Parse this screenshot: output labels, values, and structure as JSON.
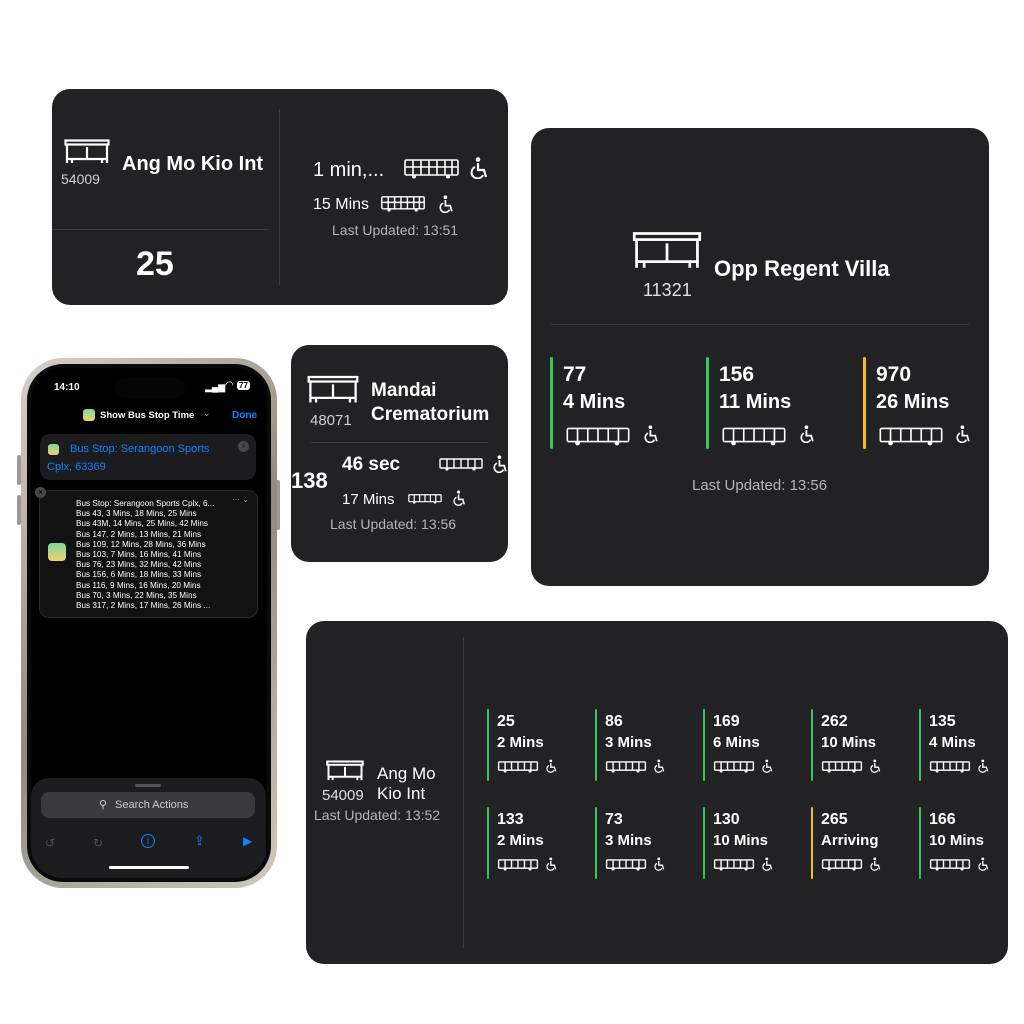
{
  "colors": {
    "green": "#34c759",
    "yellow": "#f2c01d",
    "blue": "#0a84ff",
    "widget_bg": "#222224"
  },
  "medium_widget": {
    "stop_code": "54009",
    "stop_name": "Ang Mo Kio Int",
    "service": "25",
    "next_arrival": "1 min,...",
    "following_arrival": "15 Mins",
    "last_updated": "Last Updated: 13:51"
  },
  "small_widget": {
    "stop_code": "48071",
    "stop_name_line1": "Mandai",
    "stop_name_line2": "Crematorium",
    "service": "138",
    "next_arrival": "46 sec",
    "following_arrival": "17 Mins",
    "last_updated": "Last Updated: 13:56"
  },
  "large_widget": {
    "stop_code": "11321",
    "stop_name": "Opp Regent Villa",
    "services": [
      {
        "number": "77",
        "eta": "4 Mins",
        "color": "#34c759"
      },
      {
        "number": "156",
        "eta": "11 Mins",
        "color": "#34c759"
      },
      {
        "number": "970",
        "eta": "26 Mins",
        "color": "#f2c01d"
      }
    ],
    "last_updated": "Last Updated: 13:56"
  },
  "xl_widget": {
    "stop_code": "54009",
    "stop_name_line1": "Ang Mo",
    "stop_name_line2": "Kio Int",
    "last_updated": "Last Updated: 13:52",
    "services": [
      {
        "number": "25",
        "eta": "2 Mins",
        "color": "#34c759"
      },
      {
        "number": "86",
        "eta": "3 Mins",
        "color": "#34c759"
      },
      {
        "number": "169",
        "eta": "6 Mins",
        "color": "#34c759"
      },
      {
        "number": "262",
        "eta": "10 Mins",
        "color": "#34c759"
      },
      {
        "number": "135",
        "eta": "4 Mins",
        "color": "#34c759"
      },
      {
        "number": "133",
        "eta": "2 Mins",
        "color": "#34c759"
      },
      {
        "number": "73",
        "eta": "3 Mins",
        "color": "#34c759"
      },
      {
        "number": "130",
        "eta": "10 Mins",
        "color": "#34c759"
      },
      {
        "number": "265",
        "eta": "Arriving",
        "color": "#f2c01d"
      },
      {
        "number": "166",
        "eta": "10 Mins",
        "color": "#34c759"
      }
    ]
  },
  "phone": {
    "time": "14:10",
    "battery": "77",
    "shortcut_title": "Show Bus Stop Time",
    "done_label": "Done",
    "input_line1": "Bus Stop: Serangoon Sports",
    "input_line2": "Cplx, 63369",
    "result_lines": [
      "Bus Stop: Serangoon Sports Cplx, 6...",
      "Bus 43, 3 Mins, 18 Mins, 25 Mins",
      "Bus 43M, 14 Mins, 25 Mins, 42 Mins",
      "Bus 147, 2 Mins, 13 Mins, 21 Mins",
      "Bus 109, 12 Mins, 28 Mins, 36 Mins",
      "Bus 103, 7 Mins, 16 Mins, 41 Mins",
      "Bus 76, 23 Mins, 32 Mins, 42 Mins",
      "Bus 156, 6 Mins, 18 Mins, 33 Mins",
      "Bus 116, 9 Mins, 16 Mins, 20 Mins",
      "Bus 70, 3 Mins, 22 Mins, 35 Mins",
      "Bus 317, 2 Mins, 17 Mins, 26 Mins ..."
    ],
    "search_placeholder": "Search Actions"
  }
}
